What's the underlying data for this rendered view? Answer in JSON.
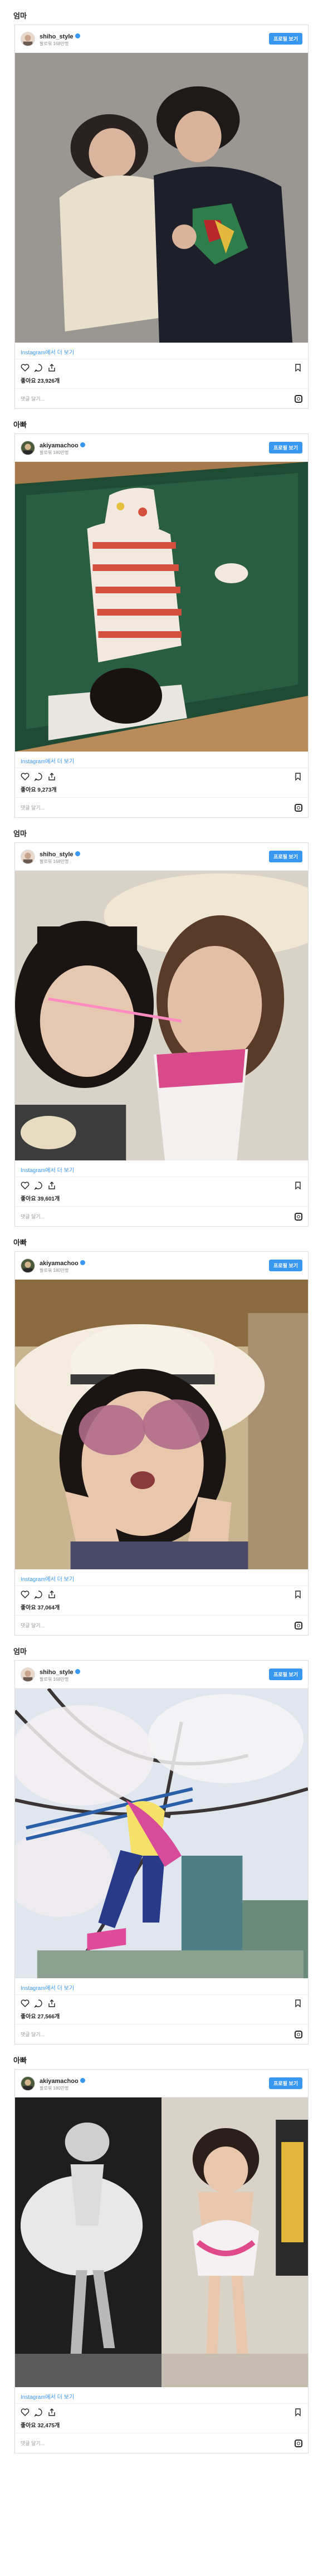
{
  "posts": [
    {
      "label": "엄마",
      "username": "shiho_style",
      "followers": "팔로워 168만명",
      "view_button": "프로필 보기",
      "more_link": "Instagram에서 더 보기",
      "likes": "좋아요 23,926개",
      "comment_placeholder": "댓글 달기...",
      "photo": "mother-daughter-lying-on-carpet"
    },
    {
      "label": "아빠",
      "username": "akiyamachoo",
      "followers": "팔로워 180만명",
      "view_button": "프로필 보기",
      "more_link": "Instagram에서 더 보기",
      "likes": "좋아요 9,273개",
      "comment_placeholder": "댓글 달기...",
      "photo": "child-lying-on-massage-table"
    },
    {
      "label": "엄마",
      "username": "shiho_style",
      "followers": "팔로워 168만명",
      "view_button": "프로필 보기",
      "more_link": "Instagram에서 더 보기",
      "likes": "좋아요 39,601개",
      "comment_placeholder": "댓글 달기...",
      "photo": "mother-daughter-selfie-with-drink"
    },
    {
      "label": "아빠",
      "username": "akiyamachoo",
      "followers": "팔로워 180만명",
      "view_button": "프로필 보기",
      "more_link": "Instagram에서 더 보기",
      "likes": "좋아요 37,064개",
      "comment_placeholder": "댓글 달기...",
      "photo": "child-hat-sunglasses-v-sign"
    },
    {
      "label": "엄마",
      "username": "shiho_style",
      "followers": "팔로워 168만명",
      "view_button": "프로필 보기",
      "more_link": "Instagram에서 더 보기",
      "likes": "좋아요 27,566개",
      "comment_placeholder": "댓글 달기...",
      "photo": "child-climbing-under-cherry-tree"
    },
    {
      "label": "아빠",
      "username": "akiyamachoo",
      "followers": "팔로워 180만명",
      "view_button": "프로필 보기",
      "more_link": "Instagram에서 더 보기",
      "likes": "좋아요 32,475개",
      "comment_placeholder": "댓글 달기...",
      "photo": "statue-and-child-pose-comparison"
    }
  ],
  "icons": {
    "like": "heart-icon",
    "comment": "comment-icon",
    "share": "share-icon",
    "save": "bookmark-icon",
    "brand": "instagram-icon"
  },
  "colors": {
    "accent": "#3897f0",
    "text": "#262626",
    "muted": "#8e8e8e",
    "border": "#dbdbdb"
  }
}
